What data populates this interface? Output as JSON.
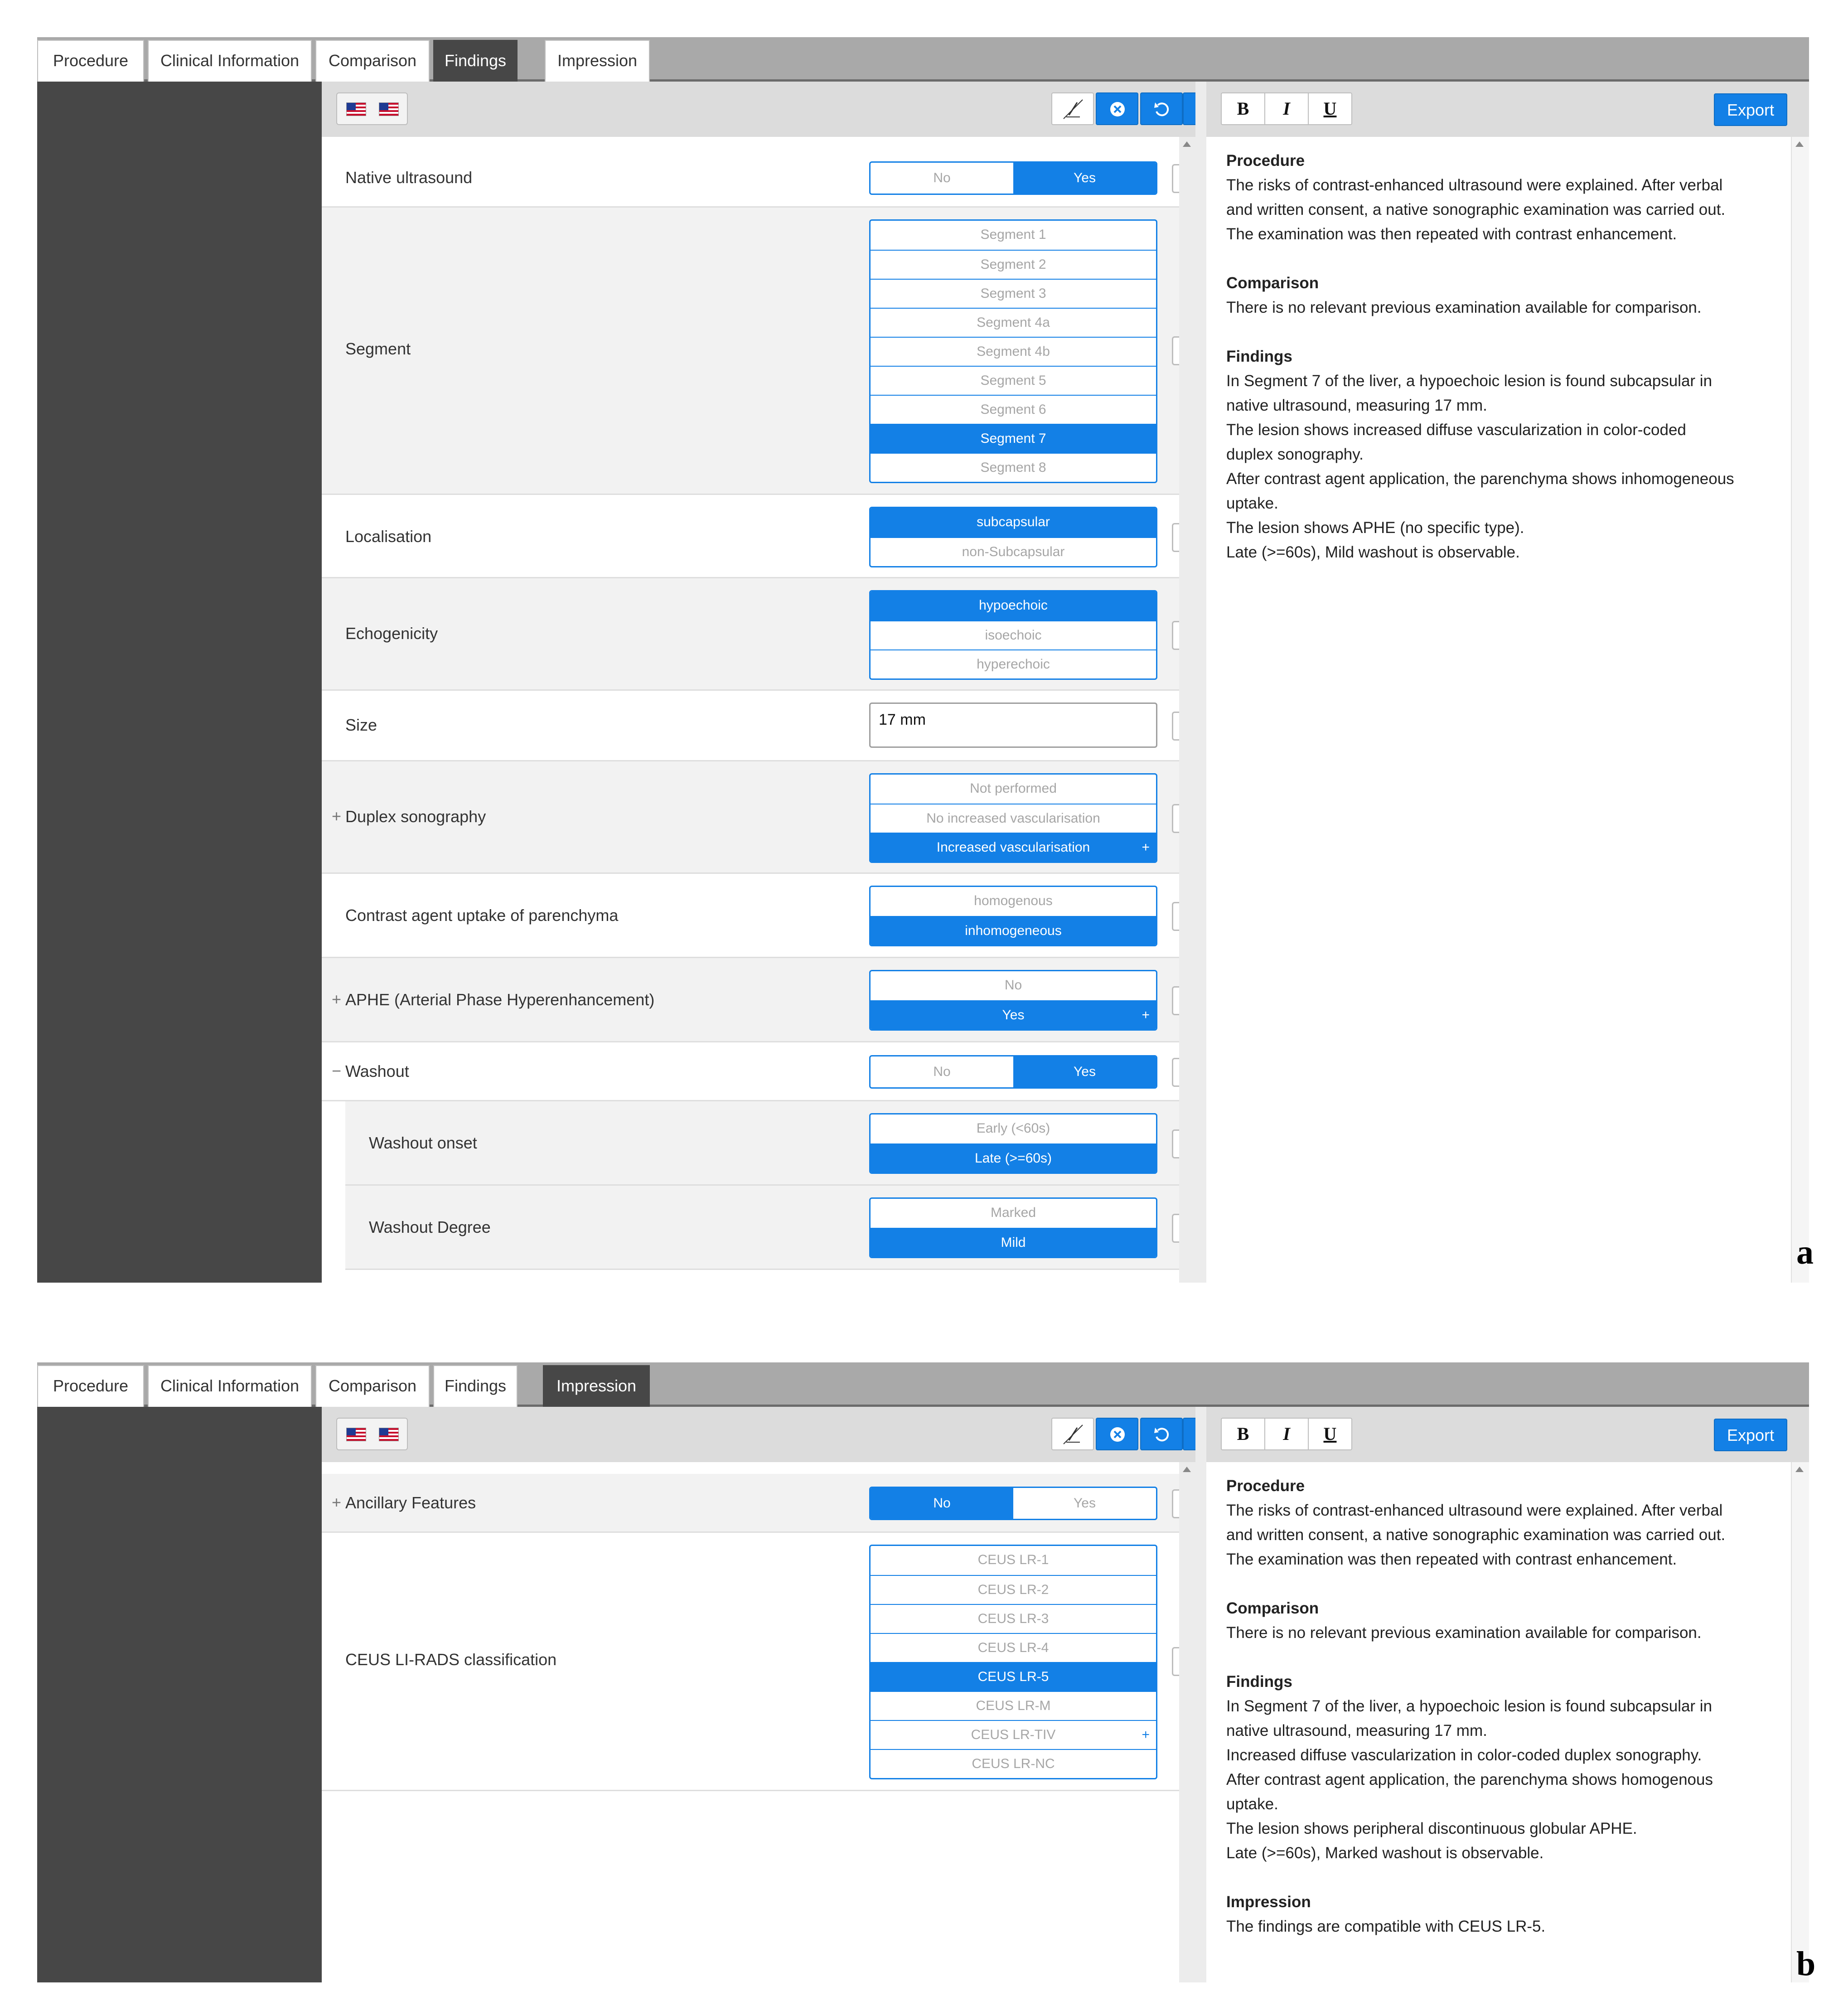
{
  "tabs": [
    "Procedure",
    "Clinical Information",
    "Comparison",
    "Findings",
    "Impression"
  ],
  "toolbar": {
    "export_label": "Export",
    "bold_label": "B",
    "italic_label": "I",
    "underline_label": "U"
  },
  "icons": {
    "flag": "us-flag-icon",
    "eraser": "no-highlight-icon",
    "clear": "clear-circle-icon",
    "undo": "undo-icon",
    "redo": "redo-icon",
    "delete": "backspace-icon"
  },
  "colors": {
    "accent": "#1380e6",
    "dark_sidebar": "#474747",
    "tab_active": "#474747"
  },
  "panel_a": {
    "active_tab": "Findings",
    "letter": "a",
    "rows": {
      "native_ultrasound": {
        "label": "Native ultrasound",
        "options": [
          "No",
          "Yes"
        ],
        "selected": "Yes"
      },
      "segment": {
        "label": "Segment",
        "options": [
          "Segment 1",
          "Segment 2",
          "Segment 3",
          "Segment 4a",
          "Segment 4b",
          "Segment 5",
          "Segment 6",
          "Segment 7",
          "Segment 8"
        ],
        "selected": "Segment 7"
      },
      "localisation": {
        "label": "Localisation",
        "options": [
          "subcapsular",
          "non-Subcapsular"
        ],
        "selected": "subcapsular"
      },
      "echogenicity": {
        "label": "Echogenicity",
        "options": [
          "hypoechoic",
          "isoechoic",
          "hyperechoic"
        ],
        "selected": "hypoechoic"
      },
      "size": {
        "label": "Size",
        "value": "17 mm"
      },
      "duplex": {
        "prefix": "+",
        "label": "Duplex sonography",
        "options": [
          "Not performed",
          "No increased vascularisation",
          "Increased vascularisation"
        ],
        "selected": "Increased vascularisation",
        "expand_mark": "+"
      },
      "contrast": {
        "label": "Contrast agent uptake of parenchyma",
        "options": [
          "homogenous",
          "inhomogeneous"
        ],
        "selected": "inhomogeneous"
      },
      "aphe": {
        "prefix": "+",
        "label": "APHE (Arterial Phase Hyperenhancement)",
        "options": [
          "No",
          "Yes"
        ],
        "selected": "Yes",
        "expand_mark": "+"
      },
      "washout": {
        "prefix": "−",
        "label": "Washout",
        "options": [
          "No",
          "Yes"
        ],
        "selected": "Yes"
      },
      "washout_onset": {
        "label": "Washout onset",
        "options": [
          "Early (<60s)",
          "Late (>=60s)"
        ],
        "selected": "Late (>=60s)"
      },
      "washout_degree": {
        "label": "Washout Degree",
        "options": [
          "Marked",
          "Mild"
        ],
        "selected": "Mild"
      }
    },
    "report": [
      {
        "heading": "Procedure",
        "lines": [
          "The risks of contrast-enhanced ultrasound were explained. After verbal",
          "and written consent, a native sonographic examination was carried out.",
          "The examination was then repeated with contrast enhancement."
        ]
      },
      {
        "heading": "Comparison",
        "lines": [
          "There is no relevant previous examination available for comparison."
        ]
      },
      {
        "heading": "Findings",
        "lines": [
          "In Segment 7 of the liver, a hypoechoic lesion is found subcapsular in",
          "native ultrasound, measuring 17 mm.",
          "The lesion shows increased diffuse vascularization in color-coded",
          "duplex sonography.",
          "After contrast agent application, the parenchyma shows inhomogeneous",
          "uptake.",
          "The lesion shows APHE (no specific type).",
          "Late (>=60s), Mild washout is observable."
        ]
      }
    ]
  },
  "panel_b": {
    "active_tab": "Impression",
    "letter": "b",
    "rows": {
      "ancillary": {
        "prefix": "+",
        "label": "Ancillary Features",
        "options": [
          "No",
          "Yes"
        ],
        "selected": "No"
      },
      "lirads": {
        "label": "CEUS LI-RADS classification",
        "options": [
          "CEUS LR-1",
          "CEUS LR-2",
          "CEUS LR-3",
          "CEUS LR-4",
          "CEUS LR-5",
          "CEUS LR-M",
          "CEUS LR-TIV",
          "CEUS LR-NC"
        ],
        "selected": "CEUS LR-5",
        "expand_mark": "+"
      }
    },
    "report": [
      {
        "heading": "Procedure",
        "lines": [
          "The risks of contrast-enhanced ultrasound were explained. After verbal",
          "and written consent, a native sonographic examination was carried out.",
          "The examination was then repeated with contrast enhancement."
        ]
      },
      {
        "heading": "Comparison",
        "lines": [
          "There is no relevant previous examination available for comparison."
        ]
      },
      {
        "heading": "Findings",
        "lines": [
          "In Segment 7 of the liver, a hypoechoic lesion is found subcapsular in",
          "native ultrasound, measuring 17 mm.",
          "Increased diffuse vascularization in color-coded duplex sonography.",
          "After contrast agent application, the parenchyma shows homogenous",
          "uptake.",
          "The lesion shows peripheral discontinuous globular APHE.",
          "Late (>=60s), Marked washout is observable."
        ]
      },
      {
        "heading": "Impression",
        "lines": [
          "The findings are compatible with CEUS LR-5."
        ]
      }
    ]
  }
}
